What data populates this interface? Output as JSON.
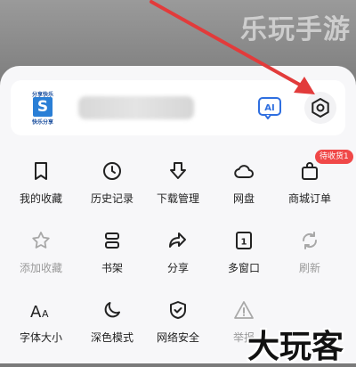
{
  "watermark_top": "乐玩手游",
  "watermark_bottom": "大玩客",
  "header": {
    "logo_top_text": "分享快乐",
    "logo_bottom_text": "快乐分享",
    "logo_letter": "S",
    "ai_label": "AI"
  },
  "menu": {
    "row1": [
      {
        "label": "我的收藏",
        "icon": "bookmark-icon"
      },
      {
        "label": "历史记录",
        "icon": "clock-icon"
      },
      {
        "label": "下载管理",
        "icon": "download-icon"
      },
      {
        "label": "网盘",
        "icon": "cloud-icon"
      },
      {
        "label": "商城订单",
        "icon": "shopping-bag-icon",
        "badge": "待收货1"
      }
    ],
    "row2": [
      {
        "label": "添加收藏",
        "icon": "star-icon",
        "disabled": true
      },
      {
        "label": "书架",
        "icon": "bookshelf-icon"
      },
      {
        "label": "分享",
        "icon": "share-icon"
      },
      {
        "label": "多窗口",
        "icon": "window-count-icon",
        "count": "1"
      },
      {
        "label": "刷新",
        "icon": "refresh-icon",
        "disabled": true
      }
    ],
    "row3": [
      {
        "label": "字体大小",
        "icon": "font-size-icon",
        "glyph": "AA"
      },
      {
        "label": "深色模式",
        "icon": "moon-icon"
      },
      {
        "label": "网络安全",
        "icon": "shield-icon"
      },
      {
        "label": "举报",
        "icon": "warning-icon",
        "disabled": true
      }
    ]
  },
  "colors": {
    "accent_red": "#e23b3b",
    "badge_red": "#f04848",
    "ai_blue": "#2f6fe0"
  }
}
